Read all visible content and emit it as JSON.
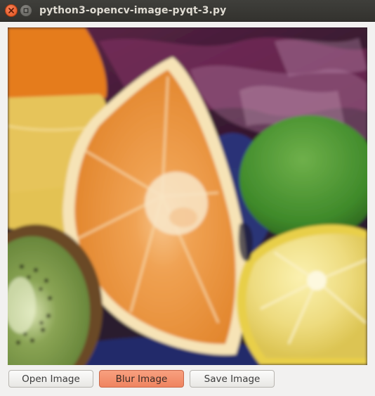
{
  "window": {
    "title": "python3-opencv-image-pyqt-3.py"
  },
  "titlebar_buttons": [
    {
      "name": "close",
      "icon": "close-icon",
      "color": "#e9602f"
    },
    {
      "name": "maximize",
      "icon": "maximize-icon",
      "color": "#6e6d68"
    }
  ],
  "image": {
    "description_icon": "fruit-photo",
    "state": "blurred"
  },
  "buttons": {
    "open_label": "Open Image",
    "blur_label": "Blur Image",
    "save_label": "Save Image"
  },
  "colors": {
    "accent_button": "#f08a66",
    "titlebar": "#3a3935",
    "window_bg": "#f2f1f0"
  }
}
